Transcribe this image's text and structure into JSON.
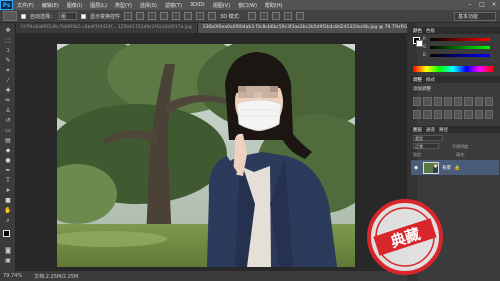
{
  "app": {
    "logo": "Ps",
    "menu": [
      "文件(F)",
      "编辑(E)",
      "图像(I)",
      "图层(L)",
      "类型(Y)",
      "选择(S)",
      "滤镜(T)",
      "3D(D)",
      "视图(V)",
      "窗口(W)",
      "帮助(H)"
    ],
    "window_controls": [
      "–",
      "□",
      "×"
    ]
  },
  "options": {
    "auto_select_label": "自动选择：",
    "auto_select_value": "组",
    "show_transform_label": "显示变换控件",
    "mode_label": "3D 模式：",
    "workspace": "基本功能"
  },
  "tabs": [
    {
      "label": "fd7f4c8a8f01d9c7b89f4b5 c6bdf1f4d24f... 125b61752d9c2f4a10d0f17a.jpg",
      "active": false
    },
    {
      "label": "236b0f0ea0e0f004ab3 f3c8cb6bc59c3f3ae2bc2b5d9f2b4c8d245320ec6b.jpg @ 79.7%(RGB/8#)",
      "active": true
    }
  ],
  "status": {
    "zoom": "79.74%",
    "doc": "文档:2.25M/2.25M"
  },
  "panels": {
    "color_tabs": [
      "颜色",
      "色板"
    ],
    "color_labels": [
      "R",
      "G",
      "B"
    ],
    "adjust_tabs": [
      "调整",
      "样式"
    ],
    "adjust_title": "添加调整",
    "layers_tabs": [
      "图层",
      "通道",
      "路径"
    ],
    "layers_kind": "类型",
    "layers_mode": "正常",
    "layers_opacity_label": "不透明度:",
    "layers_fill_label": "填充:",
    "layers_lock_label": "锁定:",
    "layer_name": "背景"
  },
  "stamp": {
    "text": "典藏"
  },
  "colors": {
    "accent": "#31a8ff",
    "stamp_red": "#d9262b",
    "selected_layer": "#4a5d78"
  }
}
